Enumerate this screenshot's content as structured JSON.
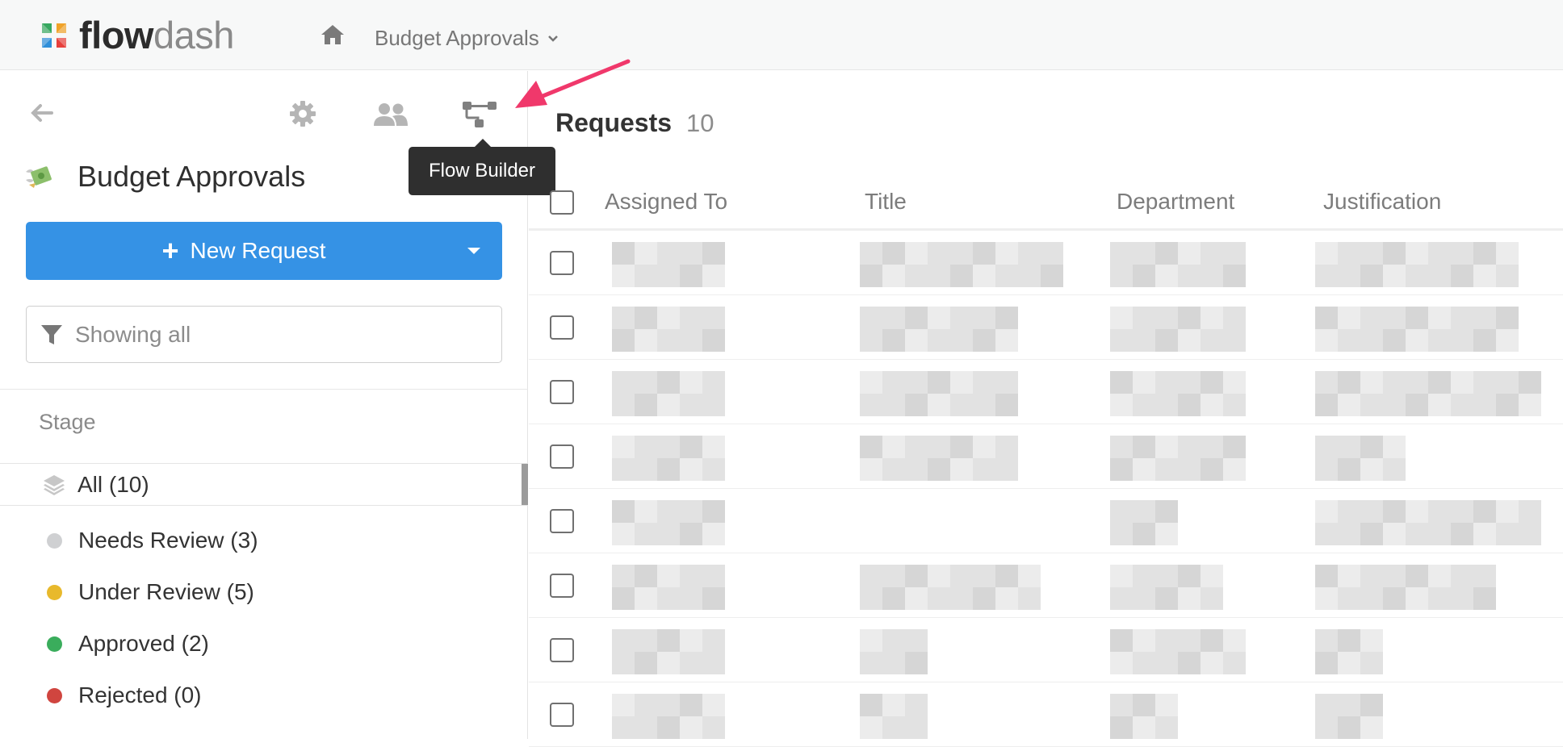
{
  "topbar": {
    "brand_flow": "flow",
    "brand_dash": "dash",
    "app_name": "Budget Approvals",
    "icons": [
      "home-icon",
      "chevron-down-icon"
    ]
  },
  "sidebar": {
    "app_title": "Budget Approvals",
    "toolbar_icons": [
      "back-arrow-icon",
      "gear-icon",
      "users-icon",
      "flow-builder-icon"
    ],
    "tooltip": "Flow Builder",
    "new_request_label": "New Request",
    "filter_placeholder": "Showing all",
    "stage_heading": "Stage",
    "stages": [
      {
        "label": "All (10)",
        "color": null,
        "active": true
      },
      {
        "label": "Needs Review (3)",
        "color": "#cfd0d2"
      },
      {
        "label": "Under Review (5)",
        "color": "#e8b92c"
      },
      {
        "label": "Approved (2)",
        "color": "#3aad5c"
      },
      {
        "label": "Rejected (0)",
        "color": "#d0453f"
      }
    ]
  },
  "main": {
    "title": "Requests",
    "count": "10",
    "columns": [
      "Assigned To",
      "Title",
      "Department",
      "Justification"
    ],
    "row_count": 8
  },
  "colors": {
    "primary": "#3592e5",
    "annotation_arrow": "#f0386b",
    "tooltip_bg": "#2f2f2f"
  }
}
